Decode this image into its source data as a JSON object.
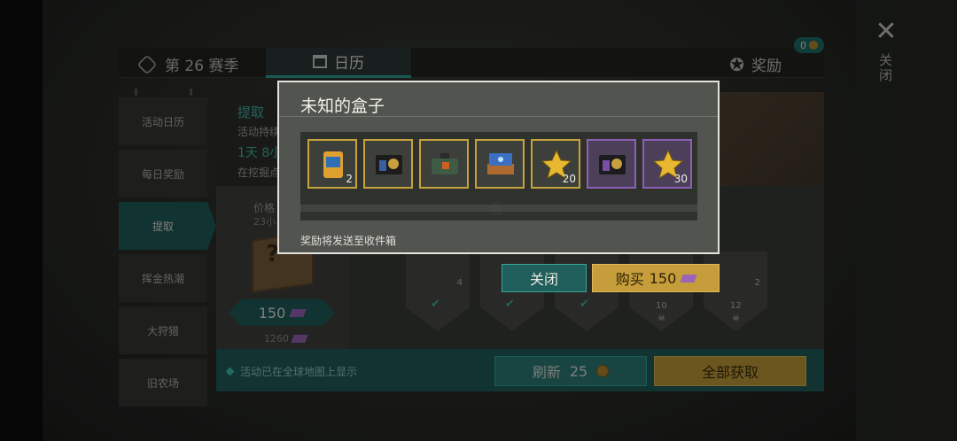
{
  "window": {
    "close_label": "关闭"
  },
  "topbar": {
    "season_label": "第 26 赛季",
    "tab_calendar": "日历",
    "rewards_label": "奖励",
    "rewards_badge": "0"
  },
  "sidebar": {
    "items": [
      {
        "label": "活动日历"
      },
      {
        "label": "每日奖励"
      },
      {
        "label": "提取",
        "active": true
      },
      {
        "label": "挥金热潮"
      },
      {
        "label": "大狩猎"
      },
      {
        "label": "旧农场"
      }
    ]
  },
  "info": {
    "title": "提取",
    "line1": "活动持续",
    "line2": "1天 8小",
    "line3": "在挖掘点"
  },
  "shop": {
    "price_label": "价格",
    "time_label": "23小",
    "price": "150",
    "old_price": "1260"
  },
  "track": [
    {
      "num": "4",
      "done": true
    },
    {
      "num": "",
      "done": true
    },
    {
      "num": "",
      "done": true
    },
    {
      "level": "10",
      "done": false
    },
    {
      "num": "2",
      "level": "12",
      "done": false
    }
  ],
  "bottom": {
    "global_note": "活动已在全球地图上显示",
    "refresh_label": "刷新",
    "refresh_cost": "25",
    "get_all_label": "全部获取"
  },
  "modal": {
    "title": "未知的盒子",
    "items": [
      {
        "icon": "food-bag-icon",
        "count": "2",
        "rarity": "gold"
      },
      {
        "icon": "badge-wallet-icon",
        "count": "",
        "rarity": "gold"
      },
      {
        "icon": "toolkit-bag-icon",
        "count": "",
        "rarity": "gold"
      },
      {
        "icon": "book-stack-icon",
        "count": "",
        "rarity": "gold"
      },
      {
        "icon": "gold-star-icon",
        "count": "20",
        "rarity": "gold"
      },
      {
        "icon": "badge-wallet-icon",
        "count": "",
        "rarity": "purple"
      },
      {
        "icon": "gold-star-icon",
        "count": "30",
        "rarity": "purple"
      }
    ],
    "note": "奖励将发送至收件箱",
    "close_button": "关闭",
    "buy_button": "购买",
    "buy_price": "150"
  },
  "colors": {
    "teal": "#1f5e5a",
    "gold": "#c59d3a",
    "purple": "#8b5fb5"
  }
}
